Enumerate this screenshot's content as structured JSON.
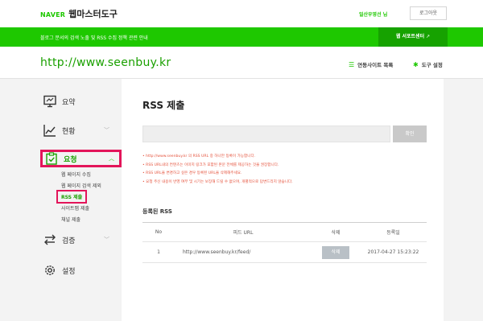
{
  "header": {
    "brand_naver": "NAVER",
    "brand_title": "웹마스터도구",
    "user_name": "일산우영선 님",
    "logout_label": "로그아웃"
  },
  "notice_bar": {
    "text": "블로그 문서의 검색 노출 및 RSS 수집 정책 관련 안내",
    "support_label": "웹 서포트센터",
    "support_icon": "external-link-icon"
  },
  "site_bar": {
    "url": "http://www.seenbuy.kr",
    "linked_sites_label": "연동사이트 목록",
    "tool_settings_label": "도구 설정"
  },
  "sidebar": {
    "items": [
      {
        "label": "요약",
        "icon": "monitor-icon"
      },
      {
        "label": "현황",
        "icon": "line-chart-icon"
      },
      {
        "label": "요청",
        "icon": "clipboard-check-icon"
      },
      {
        "label": "검증",
        "icon": "swap-arrows-icon"
      },
      {
        "label": "설정",
        "icon": "gear-icon"
      }
    ],
    "sub_items": [
      "웹 페이지 수집",
      "웹 페이지 검색 제외",
      "RSS 제출",
      "사이트맵 제출",
      "채널 제출"
    ]
  },
  "main": {
    "title": "RSS 제출",
    "input_value": "",
    "confirm_label": "확인",
    "notes": [
      "• http://www.seenbuy.kr 의 RSS URL 중 하나만 등록이 가능합니다.",
      "• RSS URL내의 컨텐츠는 이미지 링크가 포함된 본문 전체를 제공하는 것을 권장합니다.",
      "• RSS URL을 변경하고 싶은 경우 등록된 URL을 삭제해주세요.",
      "• 요청 주신 내용이 반영 여부 및 시기는 보장해 드릴 수 없으며, 개별적으로 답변드리지 않습니다."
    ],
    "registered_title": "등록된 RSS",
    "table": {
      "headers": [
        "No",
        "피드 URL",
        "삭제",
        "등록일"
      ],
      "rows": [
        {
          "no": "1",
          "url": "http://www.seenbuy.kr/feed/",
          "delete_label": "삭제",
          "date": "2017-04-27 15:23:22"
        }
      ]
    }
  },
  "colors": {
    "brand_green": "#1ec800",
    "highlight_pink": "#e3155a",
    "notice_red": "#e5533d"
  }
}
